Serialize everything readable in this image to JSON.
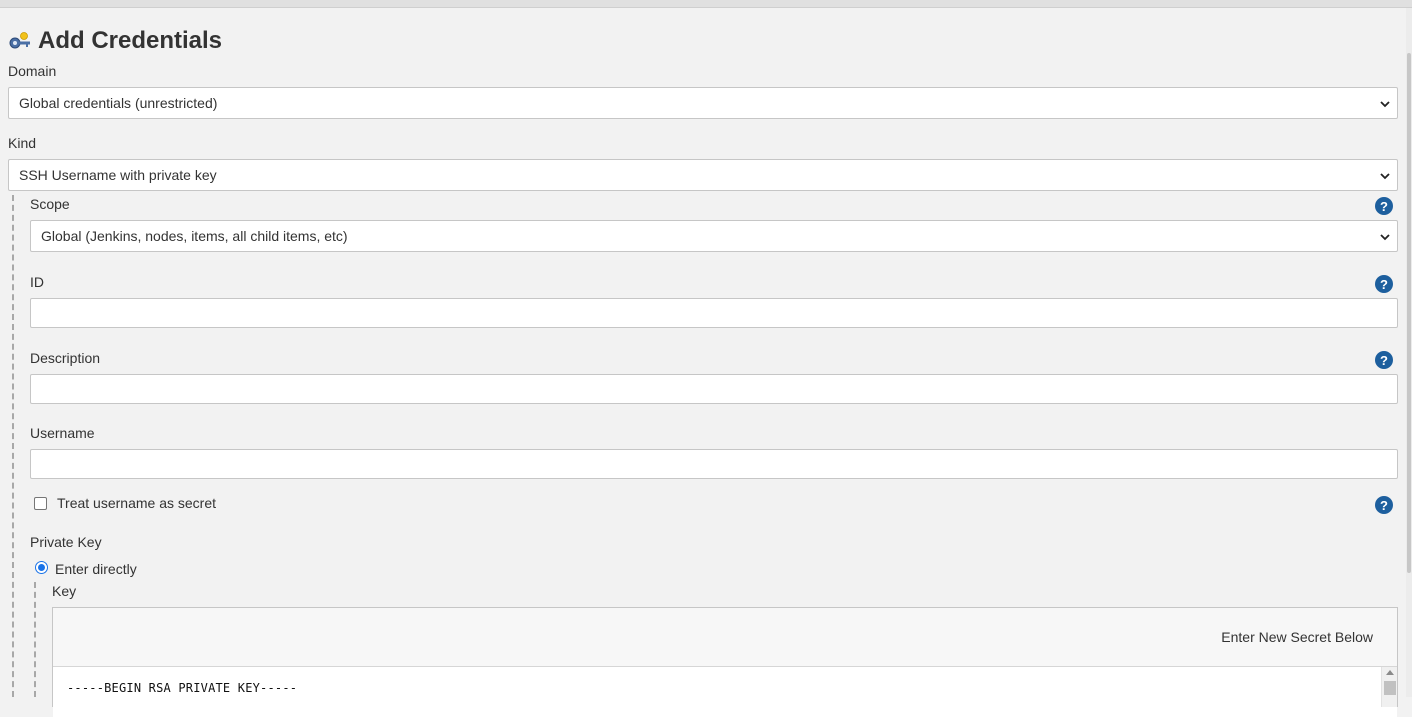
{
  "page": {
    "title": "Add Credentials"
  },
  "form": {
    "domain": {
      "label": "Domain",
      "value": "Global credentials (unrestricted)"
    },
    "kind": {
      "label": "Kind",
      "value": "SSH Username with private key"
    },
    "scope": {
      "label": "Scope",
      "value": "Global (Jenkins, nodes, items, all child items, etc)"
    },
    "id": {
      "label": "ID",
      "value": ""
    },
    "description": {
      "label": "Description",
      "value": ""
    },
    "username": {
      "label": "Username",
      "value": ""
    },
    "treat_username_secret": {
      "label": "Treat username as secret",
      "checked": false
    },
    "private_key": {
      "label": "Private Key",
      "option_enter_directly": "Enter directly",
      "key_label": "Key",
      "secret_header": "Enter New Secret Below",
      "key_text": "-----BEGIN RSA PRIVATE KEY-----"
    },
    "help_symbol": "?"
  },
  "icons": {
    "title_icon": "key-icon",
    "help_icon": "help-icon",
    "dropdown_icon": "chevron-down-icon"
  },
  "colors": {
    "background": "#f2f2f2",
    "help_icon_bg": "#1d5f9e",
    "radio_accent": "#1a73e8"
  }
}
